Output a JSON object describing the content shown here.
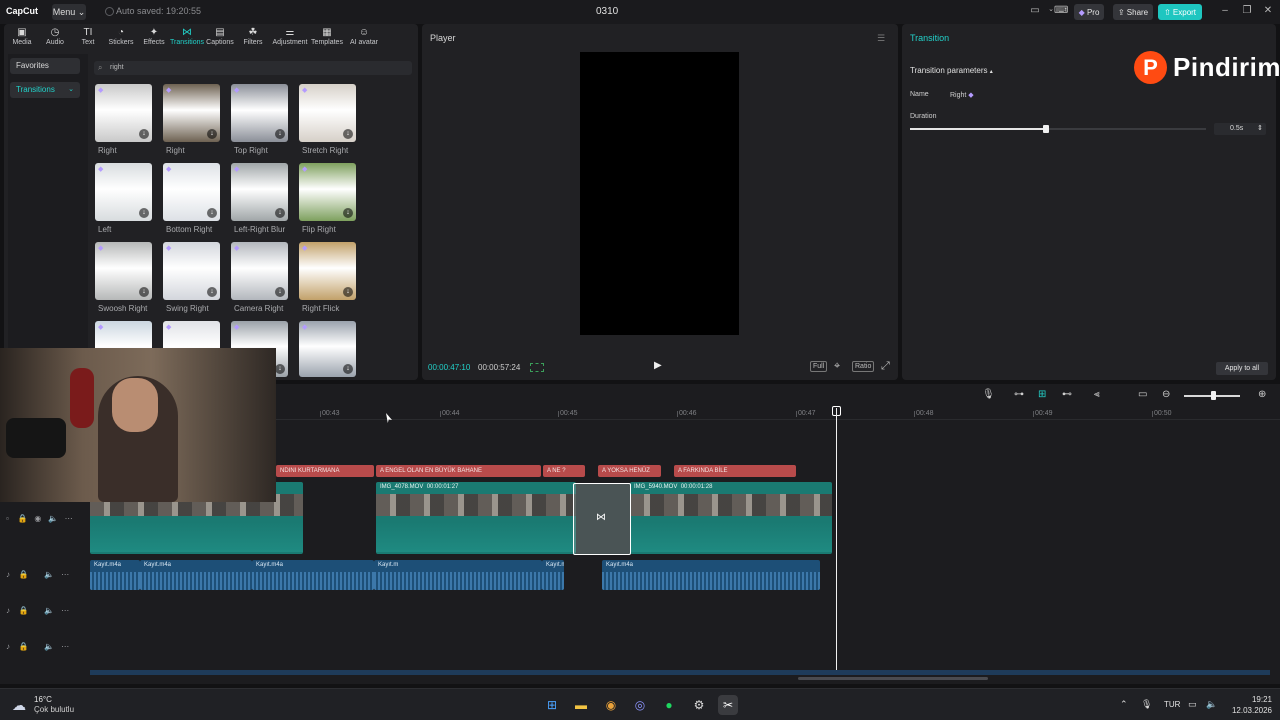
{
  "titlebar": {
    "logo": "CapCut",
    "menu": "Menu",
    "autosave": "Auto saved: 19:20:55",
    "project_title": "0310",
    "pro": "Pro",
    "share": "Share",
    "export": "Export"
  },
  "toolbar": [
    {
      "label": "Media",
      "icon": "media-icon",
      "glyph": "▣"
    },
    {
      "label": "Audio",
      "icon": "audio-icon",
      "glyph": "◷"
    },
    {
      "label": "Text",
      "icon": "text-icon",
      "glyph": "TI"
    },
    {
      "label": "Stickers",
      "icon": "stickers-icon",
      "glyph": "◔"
    },
    {
      "label": "Effects",
      "icon": "effects-icon",
      "glyph": "✦"
    },
    {
      "label": "Transitions",
      "icon": "transitions-icon",
      "glyph": "⋈"
    },
    {
      "label": "Captions",
      "icon": "captions-icon",
      "glyph": "▤"
    },
    {
      "label": "Filters",
      "icon": "filters-icon",
      "glyph": "☘"
    },
    {
      "label": "Adjustment",
      "icon": "adjustment-icon",
      "glyph": "⚌"
    },
    {
      "label": "Templates",
      "icon": "templates-icon",
      "glyph": "▦"
    },
    {
      "label": "AI avatar",
      "icon": "ai-avatar-icon",
      "glyph": "☺"
    }
  ],
  "active_tool": "Transitions",
  "sidenav": {
    "favorites": "Favorites",
    "transitions": "Transitions"
  },
  "search": {
    "value": "right"
  },
  "transitions": [
    {
      "label": "Right",
      "bg": "#c9c9c9"
    },
    {
      "label": "Right",
      "bg": "#6e6252"
    },
    {
      "label": "Top Right",
      "bg": "#8b8f98"
    },
    {
      "label": "Stretch Right",
      "bg": "#d6d0c8"
    },
    {
      "label": "Left",
      "bg": "#d8dcdf"
    },
    {
      "label": "Bottom Right",
      "bg": "#dde1e6"
    },
    {
      "label": "Left-Right Blur",
      "bg": "#a0a6a8"
    },
    {
      "label": "Flip Right",
      "bg": "#7ea05e"
    },
    {
      "label": "Swoosh Right",
      "bg": "#b6b8b8"
    },
    {
      "label": "Swing Right",
      "bg": "#d3d6dc"
    },
    {
      "label": "Camera Right",
      "bg": "#b3b7bd"
    },
    {
      "label": "Right Flick",
      "bg": "#c2a16a"
    },
    {
      "label": "",
      "bg": "#cbd6e0"
    },
    {
      "label": "",
      "bg": "#e0e2e6"
    },
    {
      "label": "",
      "bg": "#9aa1a8"
    },
    {
      "label": "",
      "bg": "#9aa2ad"
    }
  ],
  "player": {
    "title": "Player",
    "time_current": "00:00:47:10",
    "time_total": "00:00:57:24",
    "controls": [
      "Full",
      "Ratio"
    ]
  },
  "right_panel": {
    "title": "Transition",
    "params": "Transition parameters",
    "name_label": "Name",
    "name_value": "Right",
    "duration_label": "Duration",
    "duration_value": "0.5s",
    "duration_fraction": 0.46,
    "apply_all": "Apply to all",
    "brand": "Pindirim",
    "brand_badge": "P"
  },
  "timeline": {
    "ticks": [
      "00:43",
      "00:44",
      "00:45",
      "00:46",
      "00:47",
      "00:48",
      "00:49",
      "00:50"
    ],
    "text_clips": [
      "NDINI KURTARMANA",
      "ENGEL OLAN EN BÜYÜK BAHANE",
      "NE ?",
      "YOKSA HENÜZ",
      "FARKINDA BİLE"
    ],
    "video_clips": [
      {
        "name": "",
        "duration": ""
      },
      {
        "name": "IMG_4078.MOV",
        "duration": "00:00:01:27"
      },
      {
        "name": "IMG_5940.MOV",
        "duration": "00:00:01:28"
      }
    ],
    "audio_clips": [
      "Kayıt.m4a",
      "Kayıt.m4a",
      "Kayıt.m4a",
      "Kayıt.m",
      "Kayıt.m4a",
      "Kayıt.m4a"
    ]
  },
  "taskbar": {
    "temp": "16°C",
    "weather": "Çok bulutlu",
    "lang": "TUR",
    "time": "19:21",
    "date": "12.03.2026"
  }
}
